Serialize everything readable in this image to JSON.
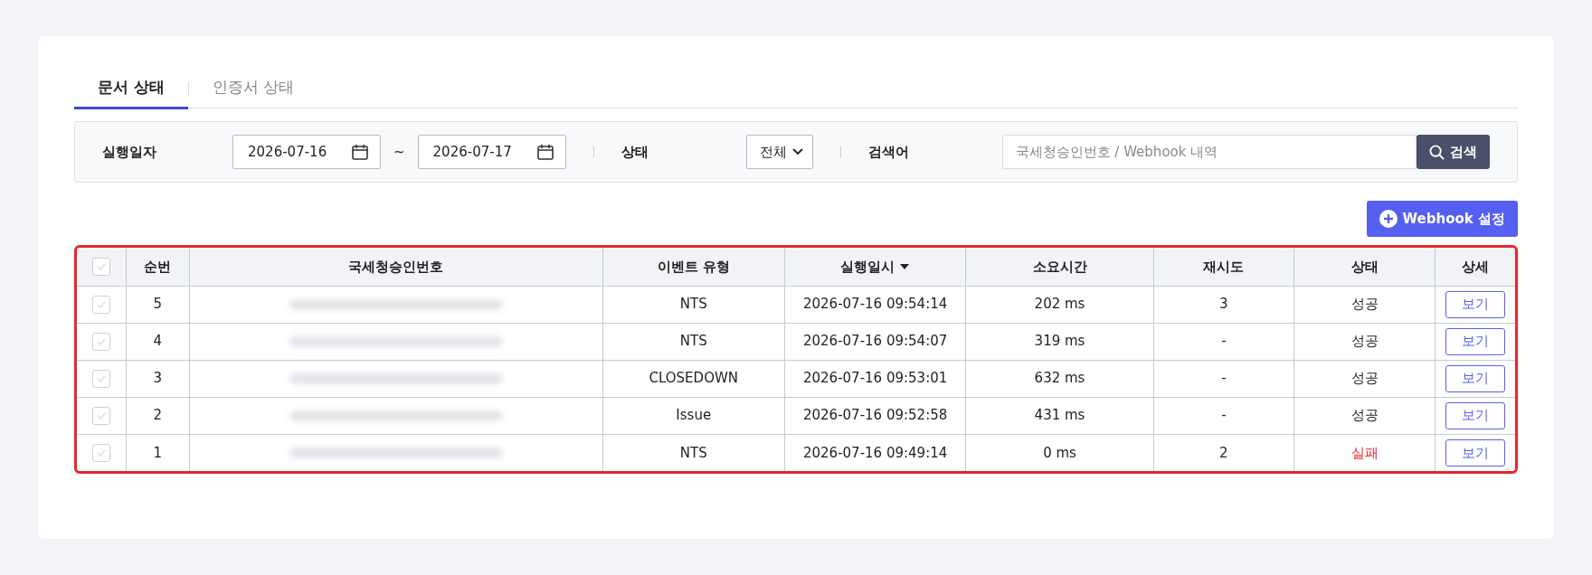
{
  "tabs": [
    {
      "label": "문서 상태",
      "selected": true
    },
    {
      "label": "인증서 상태",
      "selected": false
    }
  ],
  "filters": {
    "date_label": "실행일자",
    "date_from": "2026-07-16",
    "date_sep": "~",
    "date_to": "2026-07-17",
    "status_label": "상태",
    "status_value": "전체",
    "search_label": "검색어",
    "search_placeholder": "국세청승인번호 / Webhook 내역",
    "search_button": "검색"
  },
  "webhook_button": "Webhook 설정",
  "table": {
    "header_checked": false,
    "columns": [
      {
        "label": "순번",
        "sorted_desc": false
      },
      {
        "label": "국세청승인번호",
        "sorted_desc": false
      },
      {
        "label": "이벤트 유형",
        "sorted_desc": false
      },
      {
        "label": "실행일시",
        "sorted_desc": true
      },
      {
        "label": "소요시간",
        "sorted_desc": false
      },
      {
        "label": "재시도",
        "sorted_desc": false
      },
      {
        "label": "상태",
        "sorted_desc": false
      },
      {
        "label": "상세",
        "sorted_desc": false
      }
    ],
    "rows": [
      {
        "checked": false,
        "no": "5",
        "approval_redacted": true,
        "event": "NTS",
        "executed": "2026-07-16 09:54:14",
        "duration": "202 ms",
        "retry": "3",
        "status": "성공",
        "failed": false,
        "detail": "보기"
      },
      {
        "checked": false,
        "no": "4",
        "approval_redacted": true,
        "event": "NTS",
        "executed": "2026-07-16 09:54:07",
        "duration": "319 ms",
        "retry": "-",
        "status": "성공",
        "failed": false,
        "detail": "보기"
      },
      {
        "checked": false,
        "no": "3",
        "approval_redacted": true,
        "event": "CLOSEDOWN",
        "executed": "2026-07-16 09:53:01",
        "duration": "632 ms",
        "retry": "-",
        "status": "성공",
        "failed": false,
        "detail": "보기"
      },
      {
        "checked": false,
        "no": "2",
        "approval_redacted": true,
        "event": "Issue",
        "executed": "2026-07-16 09:52:58",
        "duration": "431 ms",
        "retry": "-",
        "status": "성공",
        "failed": false,
        "detail": "보기"
      },
      {
        "checked": false,
        "no": "1",
        "approval_redacted": true,
        "event": "NTS",
        "executed": "2026-07-16 09:49:14",
        "duration": "0 ms",
        "retry": "2",
        "status": "실패",
        "failed": true,
        "detail": "보기"
      }
    ]
  }
}
